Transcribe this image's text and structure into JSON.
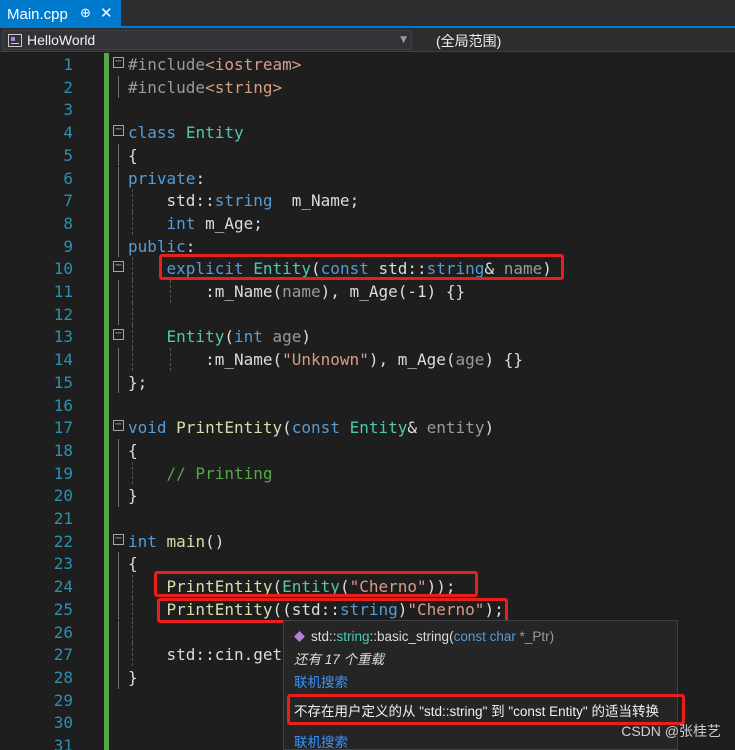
{
  "tab": {
    "title": "Main.cpp",
    "pin": "⊕",
    "close": "✕"
  },
  "nav": {
    "project": "HelloWorld",
    "scope": "(全局范围)"
  },
  "lines": [
    {
      "n": "1",
      "tokens": [
        [
          "pp",
          "#include"
        ],
        [
          "inc",
          "<iostream>"
        ]
      ]
    },
    {
      "n": "2",
      "tokens": [
        [
          "pp",
          "#include"
        ],
        [
          "inc",
          "<string>"
        ]
      ]
    },
    {
      "n": "3",
      "tokens": []
    },
    {
      "n": "4",
      "tokens": [
        [
          "kw",
          "class"
        ],
        [
          "",
          "",
          " "
        ],
        [
          "ty",
          "Entity"
        ]
      ]
    },
    {
      "n": "5",
      "tokens": [
        [
          "",
          "{"
        ]
      ]
    },
    {
      "n": "6",
      "tokens": [
        [
          "kw",
          "private"
        ],
        [
          "",
          ":"
        ]
      ]
    },
    {
      "n": "7",
      "tokens": [
        [
          "",
          "    std::"
        ],
        [
          "kw",
          "string"
        ],
        [
          "",
          "  m_Name;"
        ]
      ]
    },
    {
      "n": "8",
      "tokens": [
        [
          "",
          "    "
        ],
        [
          "kw",
          "int"
        ],
        [
          "",
          "",
          " m_Age;"
        ]
      ]
    },
    {
      "n": "9",
      "tokens": [
        [
          "kw",
          "public"
        ],
        [
          "",
          ":"
        ]
      ]
    },
    {
      "n": "10",
      "tokens": [
        [
          "",
          "    "
        ],
        [
          "kw",
          "explicit"
        ],
        [
          "",
          "",
          " "
        ],
        [
          "ty",
          "Entity"
        ],
        [
          "",
          "("
        ],
        [
          "kw",
          "const"
        ],
        [
          "",
          "",
          " std::"
        ],
        [
          "kw",
          "string"
        ],
        [
          "",
          "& "
        ],
        [
          "pa",
          "name"
        ],
        [
          "",
          ")"
        ]
      ]
    },
    {
      "n": "11",
      "tokens": [
        [
          "",
          "        :m_Name("
        ],
        [
          "pa",
          "name"
        ],
        [
          "",
          "), m_Age(-1) {}"
        ]
      ]
    },
    {
      "n": "12",
      "tokens": []
    },
    {
      "n": "13",
      "tokens": [
        [
          "",
          "    "
        ],
        [
          "ty",
          "Entity"
        ],
        [
          "",
          "("
        ],
        [
          "kw",
          "int"
        ],
        [
          "",
          "",
          " "
        ],
        [
          "pa",
          "age"
        ],
        [
          "",
          ")"
        ]
      ]
    },
    {
      "n": "14",
      "tokens": [
        [
          "",
          "        :m_Name("
        ],
        [
          "st",
          "\"Unknown\""
        ],
        [
          "",
          "), m_Age("
        ],
        [
          "pa",
          "age"
        ],
        [
          "",
          ") {}"
        ]
      ]
    },
    {
      "n": "15",
      "tokens": [
        [
          "",
          "};"
        ]
      ]
    },
    {
      "n": "16",
      "tokens": []
    },
    {
      "n": "17",
      "tokens": [
        [
          "kw",
          "void"
        ],
        [
          "",
          "",
          " "
        ],
        [
          "fn",
          "PrintEntity"
        ],
        [
          "",
          "("
        ],
        [
          "kw",
          "const"
        ],
        [
          "",
          "",
          " "
        ],
        [
          "ty",
          "Entity"
        ],
        [
          "",
          "& "
        ],
        [
          "pa",
          "entity"
        ],
        [
          "",
          ")"
        ]
      ]
    },
    {
      "n": "18",
      "tokens": [
        [
          "",
          "{"
        ]
      ]
    },
    {
      "n": "19",
      "tokens": [
        [
          "",
          "    "
        ],
        [
          "cm",
          "// Printing"
        ]
      ]
    },
    {
      "n": "20",
      "tokens": [
        [
          "",
          "}"
        ]
      ]
    },
    {
      "n": "21",
      "tokens": []
    },
    {
      "n": "22",
      "tokens": [
        [
          "kw",
          "int"
        ],
        [
          "",
          "",
          " "
        ],
        [
          "fn",
          "main"
        ],
        [
          "",
          "()"
        ]
      ]
    },
    {
      "n": "23",
      "tokens": [
        [
          "",
          "{"
        ]
      ]
    },
    {
      "n": "24",
      "tokens": [
        [
          "",
          "    "
        ],
        [
          "fn",
          "PrintEntity"
        ],
        [
          "",
          "("
        ],
        [
          "ty",
          "Entity"
        ],
        [
          "",
          "("
        ],
        [
          "st",
          "\"Cherno\""
        ],
        [
          "",
          "));"
        ]
      ]
    },
    {
      "n": "25",
      "tokens": [
        [
          "",
          "    "
        ],
        [
          "fn",
          "PrintEntity"
        ],
        [
          "",
          "((std::"
        ],
        [
          "kw",
          "string"
        ],
        [
          "",
          ")"
        ],
        [
          "st",
          "\"Cherno\""
        ],
        [
          "",
          ");"
        ]
      ]
    },
    {
      "n": "26",
      "tokens": []
    },
    {
      "n": "27",
      "tokens": [
        [
          "",
          "    std::cin.get("
        ]
      ]
    },
    {
      "n": "28",
      "tokens": [
        [
          "",
          "}"
        ]
      ]
    },
    {
      "n": "29",
      "tokens": []
    },
    {
      "n": "30",
      "tokens": []
    },
    {
      "n": "31",
      "tokens": []
    }
  ],
  "tooltip": {
    "sig_ns": "std::",
    "sig_type": "string",
    "sig_rest": "::basic_string(",
    "sig_kw": "const char",
    "sig_end": " *_Ptr)",
    "overloads": "还有 17 个重载",
    "link1": "联机搜索",
    "error": "不存在用户定义的从 \"std::string\" 到 \"const Entity\" 的适当转换",
    "link2": "联机搜索"
  },
  "watermark": "CSDN @张桂艺",
  "colors": {
    "accent": "#007acc",
    "error_box": "#e8201c",
    "change_bar": "#57a64a"
  }
}
